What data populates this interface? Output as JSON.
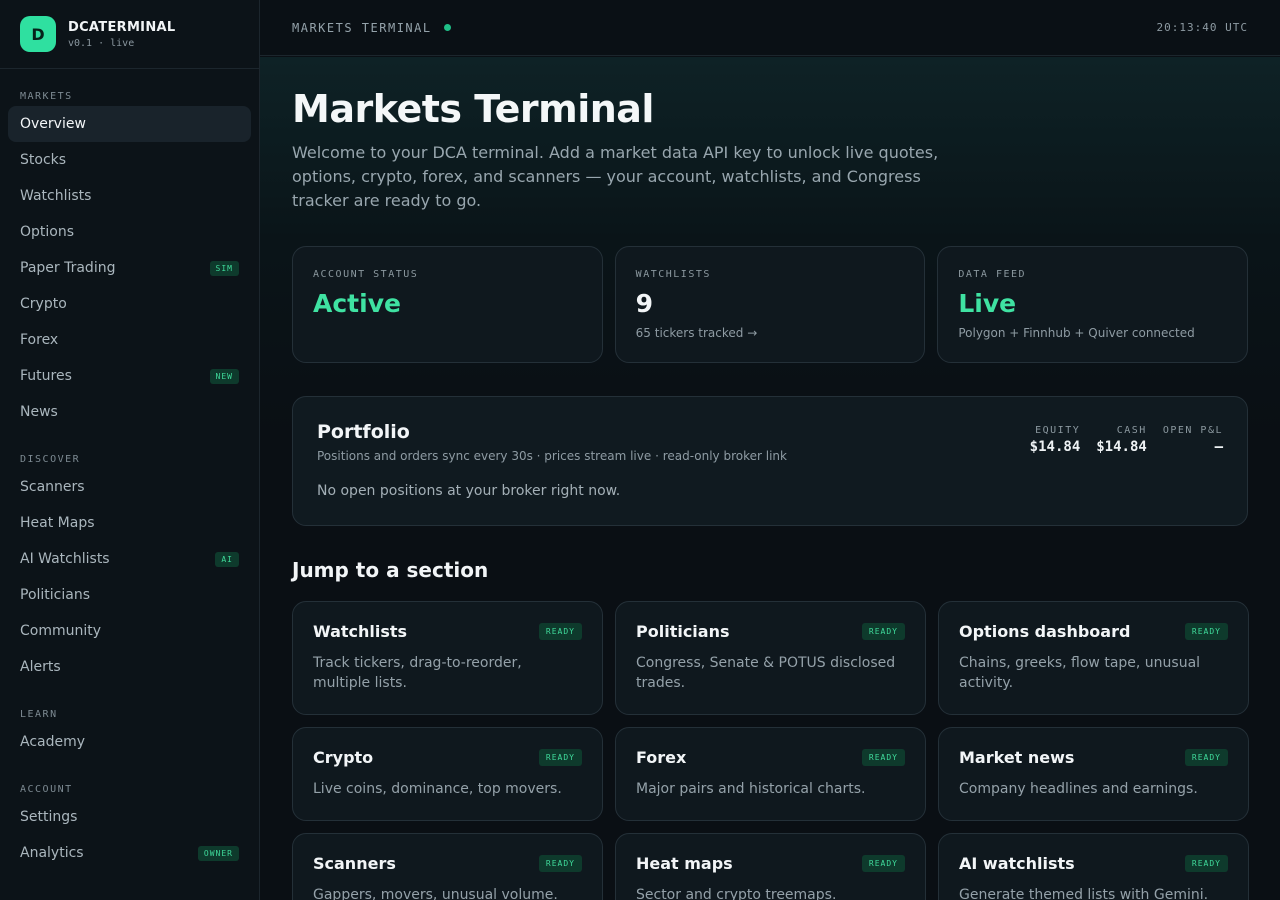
{
  "brand": {
    "logo_letter": "D",
    "name": "DCATERMINAL",
    "version": "v0.1 · live"
  },
  "sidebar": {
    "sections": [
      {
        "title": "MARKETS",
        "items": [
          {
            "label": "Overview",
            "active": true
          },
          {
            "label": "Stocks"
          },
          {
            "label": "Watchlists"
          },
          {
            "label": "Options"
          },
          {
            "label": "Paper Trading",
            "badge": "SIM"
          },
          {
            "label": "Crypto"
          },
          {
            "label": "Forex"
          },
          {
            "label": "Futures",
            "badge": "NEW"
          },
          {
            "label": "News"
          }
        ]
      },
      {
        "title": "DISCOVER",
        "items": [
          {
            "label": "Scanners"
          },
          {
            "label": "Heat Maps"
          },
          {
            "label": "AI Watchlists",
            "badge": "AI"
          },
          {
            "label": "Politicians"
          },
          {
            "label": "Community"
          },
          {
            "label": "Alerts"
          }
        ]
      },
      {
        "title": "LEARN",
        "items": [
          {
            "label": "Academy"
          }
        ]
      },
      {
        "title": "ACCOUNT",
        "items": [
          {
            "label": "Settings"
          },
          {
            "label": "Analytics",
            "badge": "OWNER"
          }
        ]
      }
    ]
  },
  "topbar": {
    "title": "MARKETS TERMINAL",
    "time": "20:13:40 UTC"
  },
  "main": {
    "title": "Markets Terminal",
    "description": "Welcome to your DCA terminal. Add a market data API key to unlock live quotes, options, crypto, forex, and scanners — your account, watchlists, and Congress tracker are ready to go.",
    "stats": [
      {
        "label": "ACCOUNT STATUS",
        "value": "Active",
        "sub": ""
      },
      {
        "label": "WATCHLISTS",
        "value": "9",
        "sub": "65 tickers tracked →"
      },
      {
        "label": "DATA FEED",
        "value": "Live",
        "sub": "Polygon + Finnhub + Quiver connected"
      }
    ],
    "portfolio": {
      "title": "Portfolio",
      "subtitle": "Positions and orders sync every 30s · prices stream live · read-only broker link",
      "empty": "No open positions at your broker right now.",
      "metrics": [
        {
          "label": "EQUITY",
          "value": "$14.84"
        },
        {
          "label": "CASH",
          "value": "$14.84"
        },
        {
          "label": "OPEN P&L",
          "value": "—"
        }
      ]
    },
    "jump_title": "Jump to a section",
    "sections": [
      {
        "title": "Watchlists",
        "badge": "READY",
        "desc": "Track tickers, drag-to-reorder, multiple lists."
      },
      {
        "title": "Politicians",
        "badge": "READY",
        "desc": "Congress, Senate & POTUS disclosed trades."
      },
      {
        "title": "Options dashboard",
        "badge": "READY",
        "desc": "Chains, greeks, flow tape, unusual activity."
      },
      {
        "title": "Crypto",
        "badge": "READY",
        "desc": "Live coins, dominance, top movers."
      },
      {
        "title": "Forex",
        "badge": "READY",
        "desc": "Major pairs and historical charts."
      },
      {
        "title": "Market news",
        "badge": "READY",
        "desc": "Company headlines and earnings."
      },
      {
        "title": "Scanners",
        "badge": "READY",
        "desc": "Gappers, movers, unusual volume."
      },
      {
        "title": "Heat maps",
        "badge": "READY",
        "desc": "Sector and crypto treemaps."
      },
      {
        "title": "AI watchlists",
        "badge": "READY",
        "desc": "Generate themed lists with Gemini."
      }
    ]
  },
  "colors": {
    "accent": "#2fe0a0",
    "positive": "#3fe2a2",
    "badge_bg": "#0e3a2c",
    "badge_fg": "#3fd99a"
  }
}
